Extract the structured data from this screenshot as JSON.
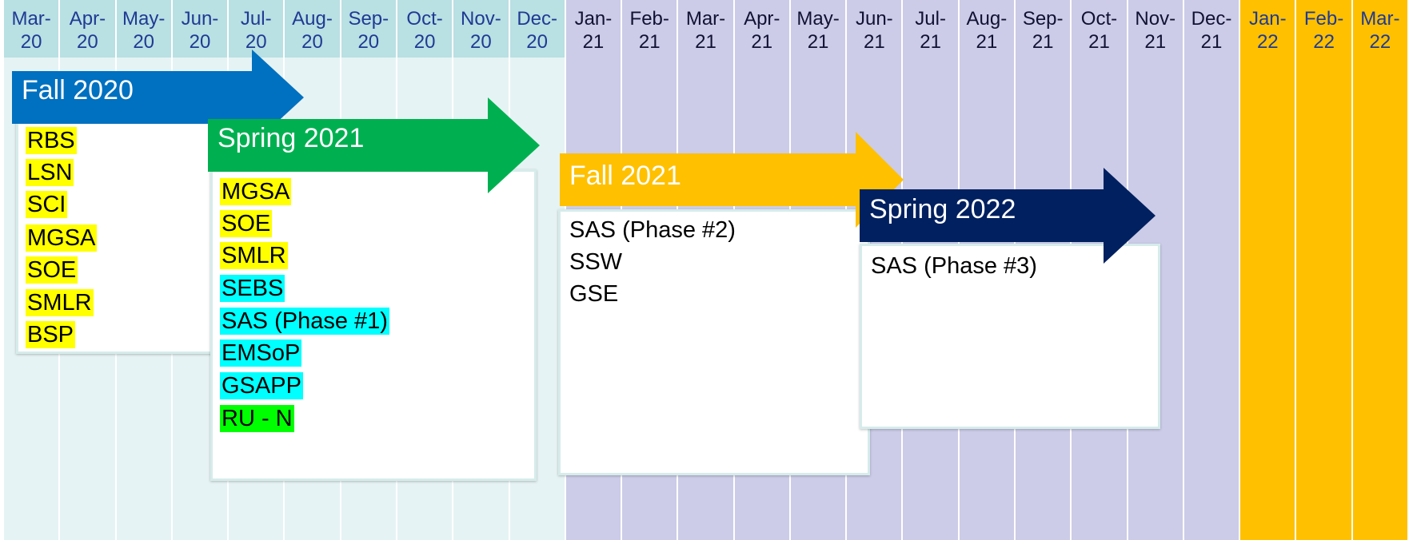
{
  "columns": [
    {
      "month": "Mar-",
      "year": "20",
      "phase": "2020"
    },
    {
      "month": "Apr-",
      "year": "20",
      "phase": "2020"
    },
    {
      "month": "May-",
      "year": "20",
      "phase": "2020"
    },
    {
      "month": "Jun-",
      "year": "20",
      "phase": "2020"
    },
    {
      "month": "Jul-",
      "year": "20",
      "phase": "2020"
    },
    {
      "month": "Aug-",
      "year": "20",
      "phase": "2020"
    },
    {
      "month": "Sep-",
      "year": "20",
      "phase": "2020"
    },
    {
      "month": "Oct-",
      "year": "20",
      "phase": "2020"
    },
    {
      "month": "Nov-",
      "year": "20",
      "phase": "2020"
    },
    {
      "month": "Dec-",
      "year": "20",
      "phase": "2020"
    },
    {
      "month": "Jan-",
      "year": "21",
      "phase": "2021"
    },
    {
      "month": "Feb-",
      "year": "21",
      "phase": "2021"
    },
    {
      "month": "Mar-",
      "year": "21",
      "phase": "2021"
    },
    {
      "month": "Apr-",
      "year": "21",
      "phase": "2021"
    },
    {
      "month": "May-",
      "year": "21",
      "phase": "2021"
    },
    {
      "month": "Jun-",
      "year": "21",
      "phase": "2021"
    },
    {
      "month": "Jul-",
      "year": "21",
      "phase": "2021"
    },
    {
      "month": "Aug-",
      "year": "21",
      "phase": "2021"
    },
    {
      "month": "Sep-",
      "year": "21",
      "phase": "2021"
    },
    {
      "month": "Oct-",
      "year": "21",
      "phase": "2021"
    },
    {
      "month": "Nov-",
      "year": "21",
      "phase": "2021"
    },
    {
      "month": "Dec-",
      "year": "21",
      "phase": "2021"
    },
    {
      "month": "Jan-",
      "year": "22",
      "phase": "2022"
    },
    {
      "month": "Feb-",
      "year": "22",
      "phase": "2022"
    },
    {
      "month": "Mar-",
      "year": "22",
      "phase": "2022"
    }
  ],
  "colors": {
    "2020": {
      "head": "#b9e0e3",
      "body": "#e6f3f4",
      "text": "#1f3a93"
    },
    "2021": {
      "head": "#cccce8",
      "body": "#cccce8",
      "text": "#111133"
    },
    "2022": {
      "head": "#ffc000",
      "body": "#ffc000",
      "text": "#1f3a93"
    },
    "highlight_yellow": "#ffff00",
    "highlight_cyan": "#00ffff",
    "highlight_green": "#00ff00"
  },
  "phases": [
    {
      "id": "fall-2020",
      "title": "Fall 2020",
      "arrow_color": "#0070c0",
      "items": [
        {
          "text": "RBS",
          "highlight": "highlight_yellow"
        },
        {
          "text": "LSN",
          "highlight": "highlight_yellow"
        },
        {
          "text": "SCI",
          "highlight": "highlight_yellow"
        },
        {
          "text": "MGSA",
          "highlight": "highlight_yellow"
        },
        {
          "text": "SOE",
          "highlight": "highlight_yellow"
        },
        {
          "text": "SMLR",
          "highlight": "highlight_yellow"
        },
        {
          "text": "BSP",
          "highlight": "highlight_yellow"
        }
      ]
    },
    {
      "id": "spring-2021",
      "title": "Spring 2021",
      "arrow_color": "#00b050",
      "items": [
        {
          "text": "MGSA",
          "highlight": "highlight_yellow"
        },
        {
          "text": "SOE",
          "highlight": "highlight_yellow"
        },
        {
          "text": "SMLR",
          "highlight": "highlight_yellow"
        },
        {
          "text": "SEBS",
          "highlight": "highlight_cyan"
        },
        {
          "text": "SAS (Phase #1)",
          "highlight": "highlight_cyan"
        },
        {
          "text": "EMSoP",
          "highlight": "highlight_cyan"
        },
        {
          "text": "GSAPP",
          "highlight": "highlight_cyan"
        },
        {
          "text": "RU - N",
          "highlight": "highlight_green"
        }
      ]
    },
    {
      "id": "fall-2021",
      "title": "Fall 2021",
      "arrow_color": "#ffc000",
      "items": [
        {
          "text": "SAS (Phase #2)",
          "highlight": ""
        },
        {
          "text": "SSW",
          "highlight": ""
        },
        {
          "text": "GSE",
          "highlight": ""
        }
      ]
    },
    {
      "id": "spring-2022",
      "title": "Spring 2022",
      "arrow_color": "#002060",
      "items": [
        {
          "text": "SAS (Phase #3)",
          "highlight": ""
        }
      ]
    }
  ]
}
